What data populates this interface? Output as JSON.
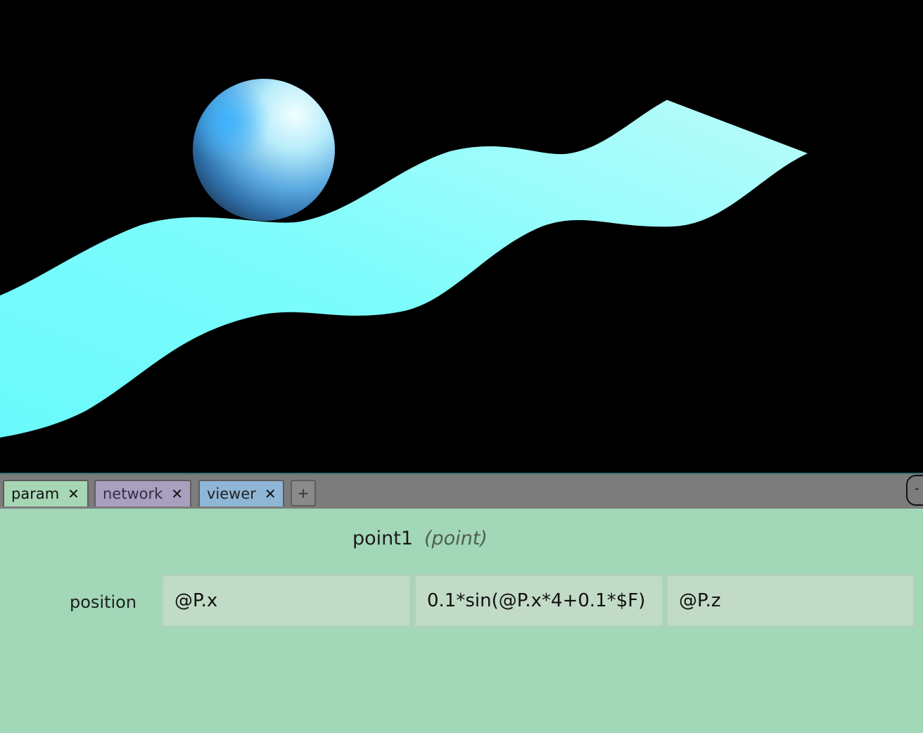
{
  "colors": {
    "viewport_bg": "#000000",
    "ribbon_fill": "#7ffcfc",
    "sphere_base": "#4a9fd8",
    "sphere_highlight": "#e8ffff",
    "tabbar_bg": "#7c7c7c",
    "panel_bg": "#a2d7b7",
    "field_bg": "#c1dbc6"
  },
  "tabs": [
    {
      "label": "param",
      "close_icon": "close-icon",
      "color": "#a7d6b5",
      "active": true
    },
    {
      "label": "network",
      "close_icon": "close-icon",
      "color": "#ab9fc0",
      "active": false
    },
    {
      "label": "viewer",
      "close_icon": "close-icon",
      "color": "#8fb6d6",
      "active": false
    }
  ],
  "tab_add_label": "+",
  "panel_collapse_label": "-",
  "node": {
    "name": "point1",
    "type": "(point)"
  },
  "params": {
    "position": {
      "label": "position",
      "x": "@P.x",
      "y": "0.1*sin(@P.x*4+0.1*$F)",
      "z": "@P.z"
    }
  }
}
